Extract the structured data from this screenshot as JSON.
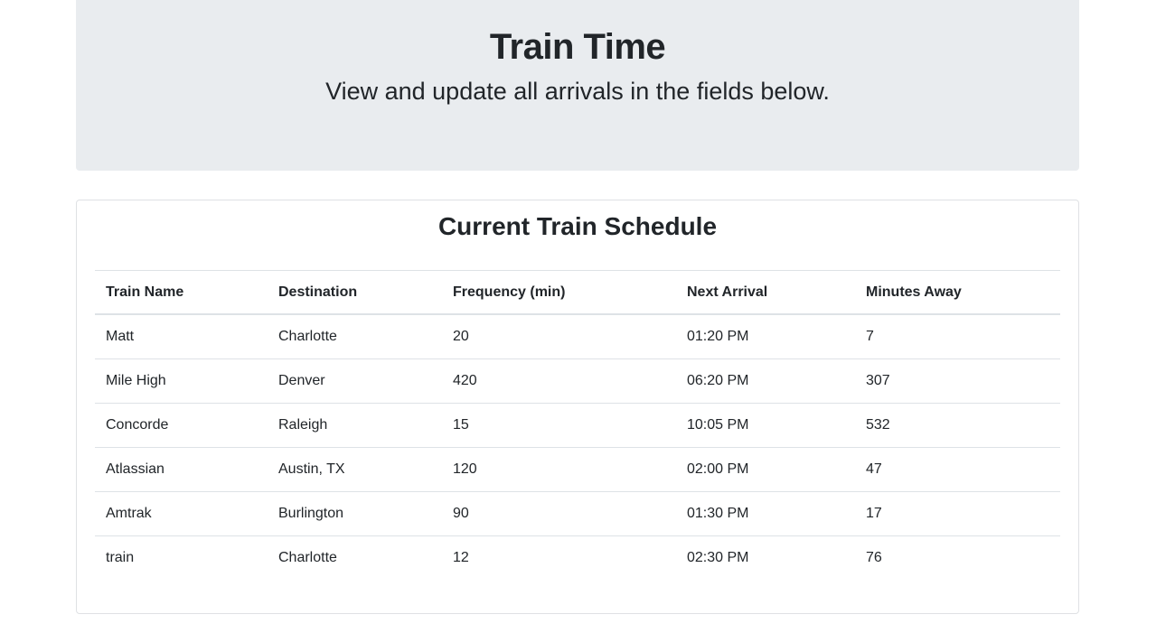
{
  "header": {
    "title": "Train Time",
    "subtitle": "View and update all arrivals in the fields below."
  },
  "schedule": {
    "title": "Current Train Schedule",
    "columns": [
      "Train Name",
      "Destination",
      "Frequency (min)",
      "Next Arrival",
      "Minutes Away"
    ],
    "rows": [
      [
        "Matt",
        "Charlotte",
        "20",
        "01:20 PM",
        "7"
      ],
      [
        "Mile High",
        "Denver",
        "420",
        "06:20 PM",
        "307"
      ],
      [
        "Concorde",
        "Raleigh",
        "15",
        "10:05 PM",
        "532"
      ],
      [
        "Atlassian",
        "Austin, TX",
        "120",
        "02:00 PM",
        "47"
      ],
      [
        "Amtrak",
        "Burlington",
        "90",
        "01:30 PM",
        "17"
      ],
      [
        "train",
        "Charlotte",
        "12",
        "02:30 PM",
        "76"
      ]
    ]
  }
}
